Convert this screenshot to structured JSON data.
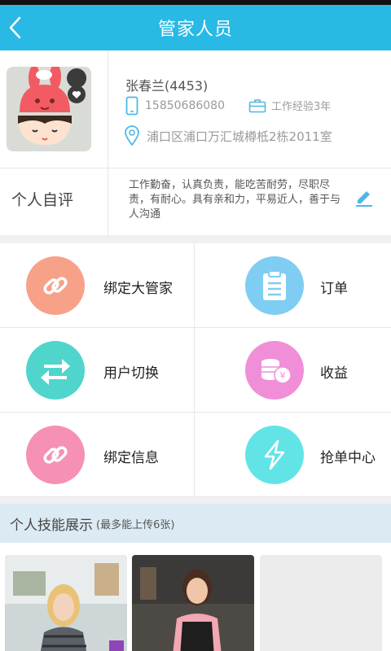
{
  "header": {
    "title": "管家人员",
    "back_icon": "chevron-left-icon"
  },
  "profile": {
    "name": "张春兰(4453)",
    "phone": "15850686080",
    "experience": "工作经验3年",
    "address": "浦口区浦口万汇城樽柢2栋2011室"
  },
  "self_eval": {
    "label": "个人自评",
    "text": "工作勤奋，认真负责，能吃苦耐劳，尽职尽责，有耐心。具有亲和力，平易近人，善于与人沟通"
  },
  "menu": [
    {
      "label": "绑定大管家",
      "icon": "link-icon",
      "color": "#f8a189"
    },
    {
      "label": "订单",
      "icon": "clipboard-icon",
      "color": "#7fcdf2"
    },
    {
      "label": "用户切换",
      "icon": "switch-arrows-icon",
      "color": "#4fd5cc"
    },
    {
      "label": "收益",
      "icon": "coins-icon",
      "color": "#f08fd8"
    },
    {
      "label": "绑定信息",
      "icon": "link-icon",
      "color": "#f690b5"
    },
    {
      "label": "抢单中心",
      "icon": "lightning-icon",
      "color": "#62e4e7"
    }
  ],
  "skills": {
    "title": "个人技能展示",
    "note": "(最多能上传6张)"
  },
  "colors": {
    "header": "#29b9e5",
    "accent": "#29b9e5"
  }
}
